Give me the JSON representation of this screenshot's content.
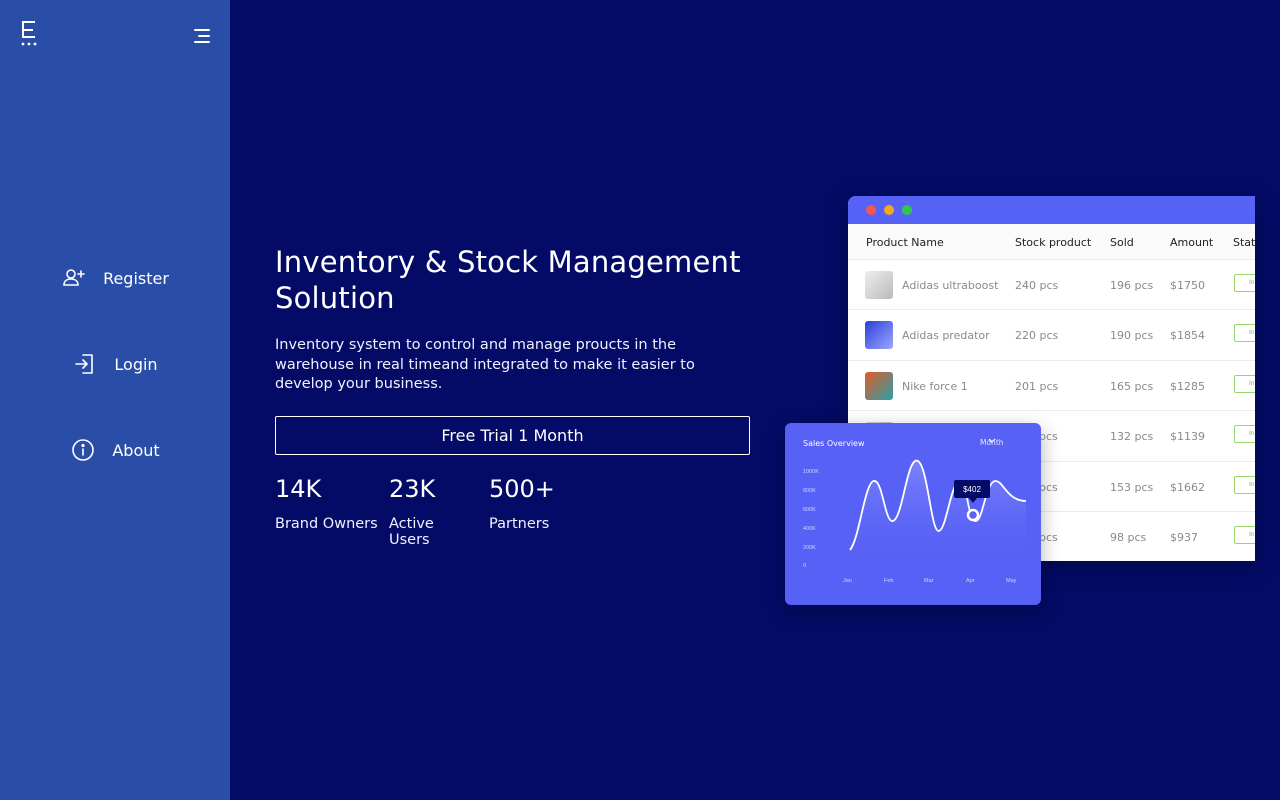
{
  "sidebar": {
    "items": [
      {
        "label": "Register",
        "icon": "user-plus-icon"
      },
      {
        "label": "Login",
        "icon": "login-icon"
      },
      {
        "label": "About",
        "icon": "info-icon"
      }
    ]
  },
  "hero": {
    "title": "Inventory & Stock Management Solution",
    "description": "Inventory system to control and manage proucts in the warehouse in real timeand integrated to make it easier to develop your business.",
    "cta_label": "Free Trial 1 Month",
    "stats": [
      {
        "value": "14K",
        "label": "Brand Owners"
      },
      {
        "value": "23K",
        "label": "Active Users"
      },
      {
        "value": "500+",
        "label": "Partners"
      }
    ]
  },
  "mockup": {
    "colors": {
      "bar": "#5662f6",
      "dot_red": "#f5564e",
      "dot_yellow": "#f5a623",
      "dot_green": "#2fc84b"
    },
    "table": {
      "columns": [
        "Product Name",
        "Stock product",
        "Sold",
        "Amount",
        "Status"
      ],
      "rows": [
        {
          "name": "Adidas ultraboost",
          "stock": "240 pcs",
          "sold": "196 pcs",
          "amount": "$1750",
          "status": "In"
        },
        {
          "name": "Adidas predator",
          "stock": "220 pcs",
          "sold": "190 pcs",
          "amount": "$1854",
          "status": "In"
        },
        {
          "name": "Nike force 1",
          "stock": "201 pcs",
          "sold": "165 pcs",
          "amount": "$1285",
          "status": "In"
        },
        {
          "name": "",
          "stock": "pcs",
          "sold": "132 pcs",
          "amount": "$1139",
          "status": "In"
        },
        {
          "name": "",
          "stock": "pcs",
          "sold": "153 pcs",
          "amount": "$1662",
          "status": "In"
        },
        {
          "name": "",
          "stock": "pcs",
          "sold": "98 pcs",
          "amount": "$937",
          "status": "In"
        }
      ]
    },
    "sales": {
      "title": "Sales Overview",
      "period": "Month",
      "y_ticks": [
        "1000K",
        "800K",
        "600K",
        "400K",
        "200K",
        "0"
      ],
      "x_ticks": [
        "Jan",
        "Feb",
        "Mar",
        "Apr",
        "May"
      ],
      "tooltip": "$402"
    }
  }
}
